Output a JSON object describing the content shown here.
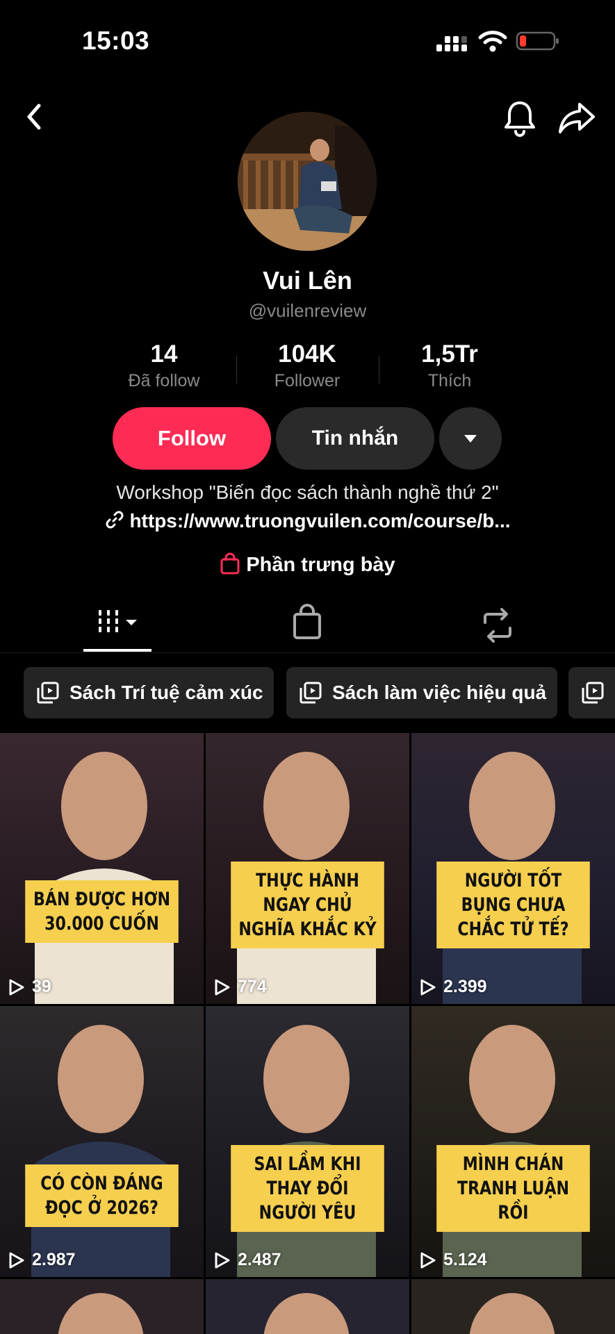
{
  "status_bar": {
    "time": "15:03"
  },
  "profile": {
    "display_name": "Vui Lên",
    "username": "@vuilenreview",
    "stats": [
      {
        "value": "14",
        "label": "Đã follow"
      },
      {
        "value": "104K",
        "label": "Follower"
      },
      {
        "value": "1,5Tr",
        "label": "Thích"
      }
    ],
    "follow_label": "Follow",
    "message_label": "Tin nhắn",
    "bio": "Workshop \"Biến đọc sách thành nghề thứ 2\"",
    "link": "https://www.truongvuilen.com/course/b...",
    "showcase_label": "Phần trưng bày"
  },
  "playlists": [
    {
      "label": "Sách Trí tuệ cảm xúc"
    },
    {
      "label": "Sách làm việc hiệu quả"
    }
  ],
  "videos": [
    {
      "caption": "BÁN ĐƯỢC HƠN 30.000 CUỐN",
      "views": "39"
    },
    {
      "caption": "THỰC HÀNH NGAY CHỦ NGHĨA KHẮC KỶ",
      "views": "774"
    },
    {
      "caption": "NGƯỜI TỐT BỤNG CHƯA CHẮC TỬ TẾ?",
      "views": "2.399"
    },
    {
      "caption": "CÓ CÒN ĐÁNG ĐỌC Ở 2026?",
      "views": "2.987"
    },
    {
      "caption": "SAI LẦM KHI THAY ĐỔI NGƯỜI YÊU",
      "views": "2.487"
    },
    {
      "caption": "MÌNH CHÁN TRANH LUẬN RỒI",
      "views": "5.124"
    }
  ],
  "colors": {
    "accent": "#fe2c55",
    "caption_bg": "#f6cf4f",
    "background": "#000000",
    "chip_bg": "#242424"
  }
}
